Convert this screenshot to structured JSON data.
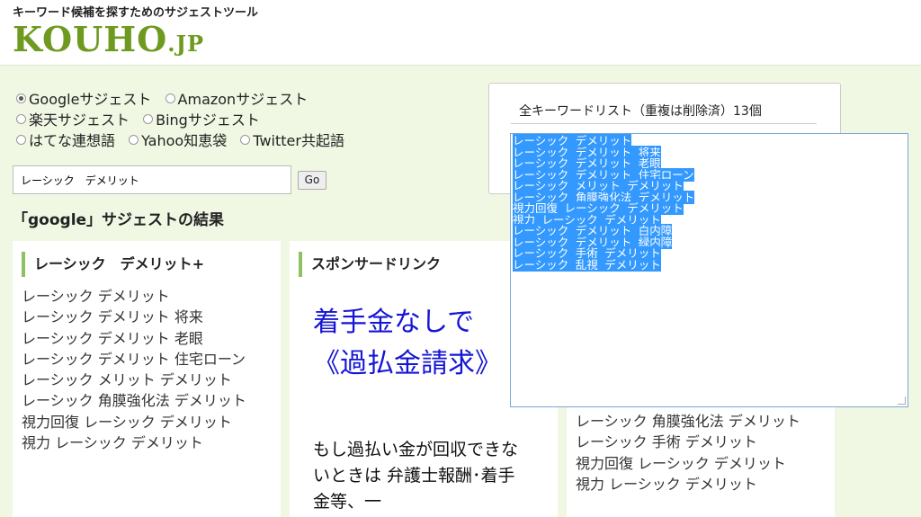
{
  "header": {
    "tagline": "キーワード候補を探すためのサジェストツール",
    "logo_main": "KOUHO",
    "logo_suffix": ".JP"
  },
  "sources": [
    [
      {
        "label": "Googleサジェスト",
        "checked": true
      },
      {
        "label": "Amazonサジェスト",
        "checked": false
      }
    ],
    [
      {
        "label": "楽天サジェスト",
        "checked": false
      },
      {
        "label": "Bingサジェスト",
        "checked": false
      }
    ],
    [
      {
        "label": "はてな連想語",
        "checked": false
      },
      {
        "label": "Yahoo知恵袋",
        "checked": false
      },
      {
        "label": "Twitter共起語",
        "checked": false
      }
    ]
  ],
  "search": {
    "value": "レーシック　デメリット",
    "go_label": "Go"
  },
  "result_heading": "「google」サジェストの結果",
  "suggest_card": {
    "title": "レーシック　デメリット+",
    "items": [
      "レーシック デメリット",
      "レーシック デメリット 将来",
      "レーシック デメリット 老眼",
      "レーシック デメリット 住宅ローン",
      "レーシック メリット デメリット",
      "レーシック 角膜強化法 デメリット",
      "視力回復 レーシック デメリット",
      "視力 レーシック デメリット"
    ]
  },
  "sponsor_card": {
    "title": "スポンサードリンク",
    "ad_headline": "着手金なしで《過払金請求》",
    "ad_body": "もし過払い金が回収できないときは 弁護士報酬･着手金等、一"
  },
  "keyword_panel": {
    "title": "全キーワードリスト（重複は削除済）13個"
  },
  "keyword_list": [
    "レーシック デメリット",
    "レーシック デメリット 将来",
    "レーシック デメリット 老眼",
    "レーシック デメリット 住宅ローン",
    "レーシック メリット デメリット",
    "レーシック 角膜強化法 デメリット",
    "視力回復 レーシック デメリット",
    "視力 レーシック デメリット",
    "レーシック デメリット 白内障",
    "レーシック デメリット 緑内障",
    "レーシック 手術 デメリット",
    "レーシック 乱視 デメリット"
  ],
  "third_card": {
    "items": [
      "レーシック 角膜強化法 デメリット",
      "レーシック 手術 デメリット",
      "視力回復 レーシック デメリット",
      "視力 レーシック デメリット"
    ]
  },
  "colors": {
    "background": "#f0f8e4",
    "logo": "#6d9a1f",
    "card_accent": "#8dc262",
    "ad_link": "#1515d6",
    "selection": "#3399ff"
  }
}
